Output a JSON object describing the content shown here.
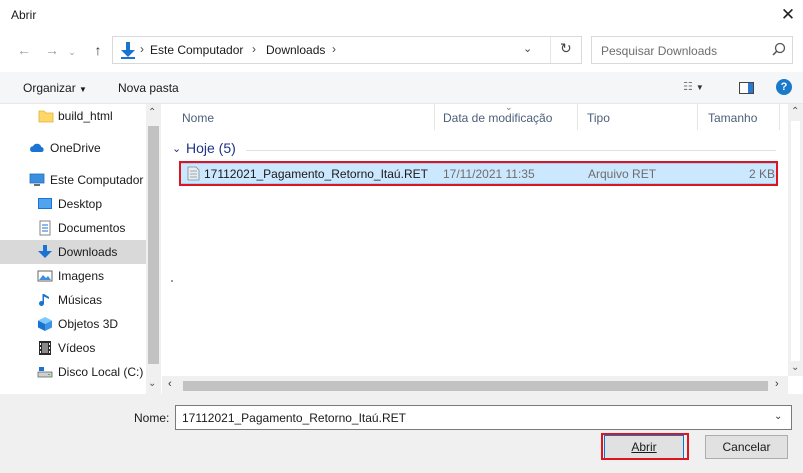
{
  "window": {
    "title": "Abrir",
    "close_glyph": "✕"
  },
  "address": {
    "crumbs": [
      "Este Computador",
      "Downloads"
    ],
    "separator": "›",
    "search_placeholder": "Pesquisar Downloads"
  },
  "toolbar": {
    "organize": "Organizar",
    "new_folder": "Nova pasta"
  },
  "nav": {
    "items": [
      {
        "label": "build_html",
        "icon": "folder-icon"
      },
      {
        "label": "OneDrive",
        "icon": "onedrive-icon"
      },
      {
        "label": "Este Computador",
        "icon": "computer-icon"
      },
      {
        "label": "Desktop",
        "icon": "desktop-icon"
      },
      {
        "label": "Documentos",
        "icon": "documents-icon"
      },
      {
        "label": "Downloads",
        "icon": "downloads-icon",
        "selected": true
      },
      {
        "label": "Imagens",
        "icon": "pictures-icon"
      },
      {
        "label": "Músicas",
        "icon": "music-icon"
      },
      {
        "label": "Objetos 3D",
        "icon": "objects3d-icon"
      },
      {
        "label": "Vídeos",
        "icon": "videos-icon"
      },
      {
        "label": "Disco Local (C:)",
        "icon": "drive-icon"
      }
    ]
  },
  "list": {
    "columns": [
      "Nome",
      "Data de modificação",
      "Tipo",
      "Tamanho"
    ],
    "group": "Hoje (5)",
    "files": [
      {
        "name": "17112021_Pagamento_Retorno_Itaú.RET",
        "modified": "17/11/2021 11:35",
        "type": "Arquivo RET",
        "size": "2 KB"
      }
    ]
  },
  "bottom": {
    "name_label": "Nome:",
    "name_value": "17112021_Pagamento_Retorno_Itaú.RET",
    "open_label": "Abrir",
    "cancel_label": "Cancelar"
  },
  "colors": {
    "accent": "#0078d7",
    "highlight": "#e0141f",
    "selection": "#cce8ff"
  }
}
